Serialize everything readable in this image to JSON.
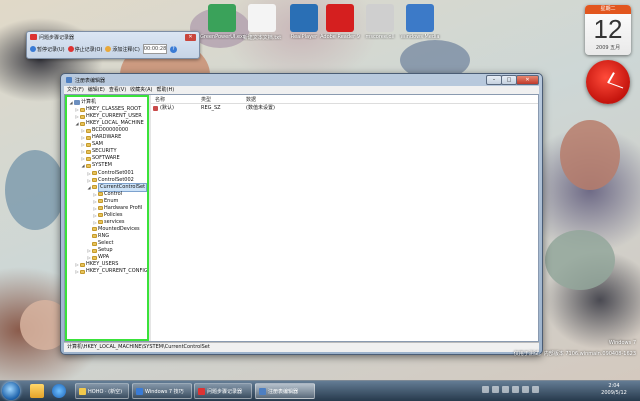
{
  "desktop": {
    "icons": [
      {
        "label": "GreenPowerUI.exe",
        "color": "#3aa25a"
      },
      {
        "label": "新建文本文档.txt",
        "color": "#f4f4f4"
      },
      {
        "label": "RealPlayer",
        "color": "#2a6fb5"
      },
      {
        "label": "Adobe Reader 9",
        "color": "#d51f1f"
      },
      {
        "label": "mscoree.dll",
        "color": "#cfcfcf"
      },
      {
        "label": "Windows Media",
        "color": "#3c7ac8"
      }
    ]
  },
  "calendar_gadget": {
    "weekday": "星期二",
    "day": "12",
    "year_month": "2009 五月"
  },
  "recorder": {
    "title": "问题步骤记录器",
    "start_label": "暂停记录(U)",
    "stop_label": "停止记录(O)",
    "comment_label": "添加注释(C)",
    "time": "00:00:28"
  },
  "regedit": {
    "title": "注册表编辑器",
    "menu": [
      "文件(F)",
      "编辑(E)",
      "查看(V)",
      "收藏夹(A)",
      "帮助(H)"
    ],
    "tree": [
      {
        "label": "计算机",
        "level": 0,
        "exp": "◢",
        "type": "computer"
      },
      {
        "label": "HKEY_CLASSES_ROOT",
        "level": 1,
        "exp": "▷",
        "type": "folder"
      },
      {
        "label": "HKEY_CURRENT_USER",
        "level": 1,
        "exp": "▷",
        "type": "folder"
      },
      {
        "label": "HKEY_LOCAL_MACHINE",
        "level": 1,
        "exp": "◢",
        "type": "folder"
      },
      {
        "label": "BCD00000000",
        "level": 2,
        "exp": "▷",
        "type": "folder"
      },
      {
        "label": "HARDWARE",
        "level": 2,
        "exp": "▷",
        "type": "folder"
      },
      {
        "label": "SAM",
        "level": 2,
        "exp": "▷",
        "type": "folder"
      },
      {
        "label": "SECURITY",
        "level": 2,
        "exp": "▷",
        "type": "folder"
      },
      {
        "label": "SOFTWARE",
        "level": 2,
        "exp": "▷",
        "type": "folder"
      },
      {
        "label": "SYSTEM",
        "level": 2,
        "exp": "◢",
        "type": "folder"
      },
      {
        "label": "ControlSet001",
        "level": 3,
        "exp": "▷",
        "type": "folder"
      },
      {
        "label": "ControlSet002",
        "level": 3,
        "exp": "▷",
        "type": "folder"
      },
      {
        "label": "CurrentControlSet",
        "level": 3,
        "exp": "◢",
        "type": "folder",
        "selected": true
      },
      {
        "label": "Control",
        "level": 4,
        "exp": "▷",
        "type": "folder"
      },
      {
        "label": "Enum",
        "level": 4,
        "exp": "▷",
        "type": "folder"
      },
      {
        "label": "Hardware Profil",
        "level": 4,
        "exp": "▷",
        "type": "folder"
      },
      {
        "label": "Policies",
        "level": 4,
        "exp": "▷",
        "type": "folder"
      },
      {
        "label": "services",
        "level": 4,
        "exp": "▷",
        "type": "folder"
      },
      {
        "label": "MountedDevices",
        "level": 3,
        "exp": "",
        "type": "folder"
      },
      {
        "label": "RNG",
        "level": 3,
        "exp": "",
        "type": "folder"
      },
      {
        "label": "Select",
        "level": 3,
        "exp": "",
        "type": "folder"
      },
      {
        "label": "Setup",
        "level": 3,
        "exp": "▷",
        "type": "folder"
      },
      {
        "label": "WPA",
        "level": 3,
        "exp": "▷",
        "type": "folder"
      },
      {
        "label": "HKEY_USERS",
        "level": 1,
        "exp": "▷",
        "type": "folder"
      },
      {
        "label": "HKEY_CURRENT_CONFIG",
        "level": 1,
        "exp": "▷",
        "type": "folder"
      }
    ],
    "columns": {
      "name": "名称",
      "type": "类型",
      "data": "数据"
    },
    "rows": [
      {
        "name": "(默认)",
        "type": "REG_SZ",
        "data": "(数值未设置)"
      }
    ],
    "status": "计算机\\HKEY_LOCAL_MACHINE\\SYSTEM\\CurrentControlSet"
  },
  "watermark": {
    "line1": "Windows 7",
    "line2": "仅用于测试。内部版本 7106.winmain.090408-1623"
  },
  "taskbar": {
    "tasks": [
      {
        "label": "HOHO · (新空)",
        "color": "#f2c94c"
      },
      {
        "label": "Windows 7 技巧",
        "color": "#3a7bd5"
      },
      {
        "label": "问题步骤记录器",
        "color": "#d33"
      },
      {
        "label": "注册表编辑器",
        "color": "#4d7fc2",
        "active": true
      }
    ],
    "time": "2:04",
    "date": "2009/5/12"
  }
}
